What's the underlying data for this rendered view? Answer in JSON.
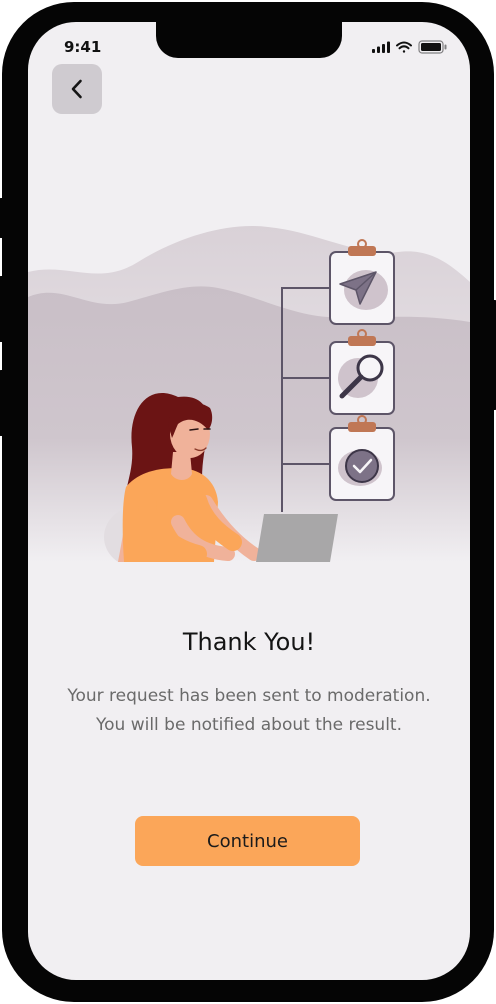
{
  "status_bar": {
    "time": "9:41",
    "icons": [
      "cellular-signal-icon",
      "wifi-icon",
      "battery-icon"
    ]
  },
  "navigation": {
    "back_icon": "chevron-left-icon"
  },
  "illustration": {
    "subject": "woman-at-laptop-with-checklist",
    "steps": [
      "paper-plane-icon",
      "magnifier-icon",
      "checkmark-icon"
    ]
  },
  "content": {
    "title": "Thank You!",
    "message_line1": "Your request has been sent to moderation.",
    "message_line2": "You will be notified about the result."
  },
  "actions": {
    "continue_label": "Continue"
  },
  "colors": {
    "background": "#f1eff2",
    "accent": "#fba659",
    "back_button_bg": "#cfcbd0",
    "hill": "#c8bec6",
    "clipboard_clip": "#c07755"
  }
}
